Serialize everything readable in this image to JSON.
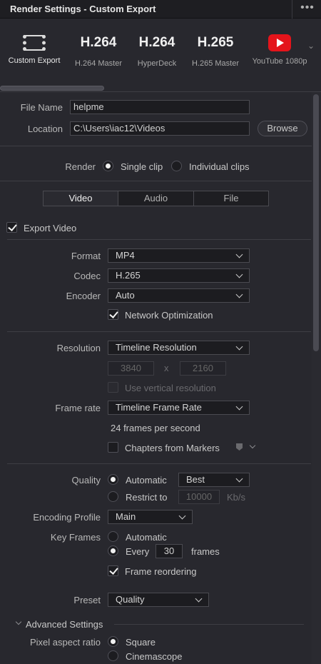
{
  "window": {
    "title": "Render Settings - Custom Export",
    "more_icon": "ellipsis-icon"
  },
  "presets": [
    {
      "icon": "film-strip-icon",
      "label": "Custom Export",
      "active": true
    },
    {
      "big": "H.264",
      "label": "H.264 Master"
    },
    {
      "big": "H.264",
      "label": "HyperDeck"
    },
    {
      "big": "H.265",
      "label": "H.265 Master"
    },
    {
      "icon": "youtube-icon",
      "label": "YouTube 1080p"
    }
  ],
  "file": {
    "name_label": "File Name",
    "name_value": "helpme",
    "location_label": "Location",
    "location_value": "C:\\Users\\iac12\\Videos",
    "browse_label": "Browse"
  },
  "render": {
    "label": "Render",
    "single_clip": "Single clip",
    "individual_clips": "Individual clips",
    "selected": "single"
  },
  "tabs": [
    "Video",
    "Audio",
    "File"
  ],
  "video": {
    "export_video": "Export Video",
    "format_label": "Format",
    "format_value": "MP4",
    "codec_label": "Codec",
    "codec_value": "H.265",
    "encoder_label": "Encoder",
    "encoder_value": "Auto",
    "network_opt": "Network Optimization",
    "resolution_label": "Resolution",
    "resolution_value": "Timeline Resolution",
    "res_width": "3840",
    "res_x": "x",
    "res_height": "2160",
    "use_vertical": "Use vertical resolution",
    "framerate_label": "Frame rate",
    "framerate_value": "Timeline Frame Rate",
    "fps_text": "24 frames per second",
    "chapters": "Chapters from Markers",
    "quality_label": "Quality",
    "quality_auto": "Automatic",
    "quality_auto_value": "Best",
    "quality_restrict": "Restrict to",
    "restrict_value": "10000",
    "restrict_unit": "Kb/s",
    "encoding_profile_label": "Encoding Profile",
    "encoding_profile_value": "Main",
    "keyframes_label": "Key Frames",
    "keyframes_auto": "Automatic",
    "keyframes_every": "Every",
    "keyframes_every_value": "30",
    "keyframes_unit": "frames",
    "frame_reordering": "Frame reordering",
    "preset_label": "Preset",
    "preset_value": "Quality",
    "advanced": "Advanced Settings",
    "par_label": "Pixel aspect ratio",
    "par_square": "Square",
    "par_cinemascope": "Cinemascope"
  }
}
